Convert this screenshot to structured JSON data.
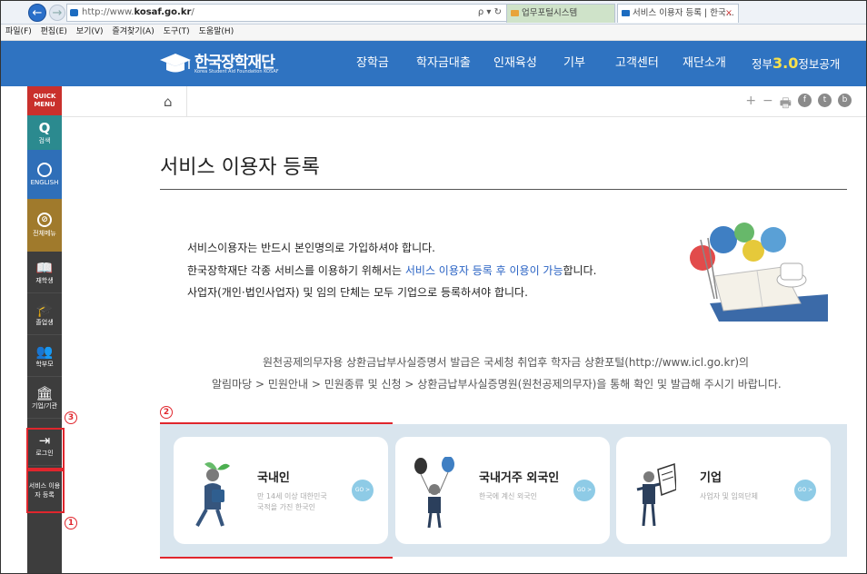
{
  "browser": {
    "url_prefix": "http://www.",
    "url_domain": "kosaf.go.kr",
    "url_suffix": "/",
    "url_controls": "ρ ▾ ↻",
    "tabs": [
      {
        "label": "업무포털시스템"
      },
      {
        "label": "서비스 이용자 등록 | 한국...",
        "close": "×"
      }
    ],
    "menu": [
      "파일(F)",
      "편집(E)",
      "보기(V)",
      "즐겨찾기(A)",
      "도구(T)",
      "도움말(H)"
    ]
  },
  "header": {
    "logo_name": "한국장학재단",
    "logo_sub": "Korea Student Aid Foundation KOSAF",
    "nav": [
      "장학금",
      "학자금대출",
      "인재육성",
      "기부",
      "고객센터",
      "재단소개"
    ],
    "gov_prefix": "정부",
    "gov_number": "3.0",
    "gov_suffix": "정보공개"
  },
  "quick_menu": {
    "top": "QUICK MENU",
    "items": [
      {
        "label": "검색",
        "icon": "search-icon"
      },
      {
        "label": "ENGLISH",
        "icon": "globe-icon"
      },
      {
        "label": "전체메뉴",
        "icon": "compass-icon"
      },
      {
        "label": "재학생",
        "icon": "book-icon"
      },
      {
        "label": "졸업생",
        "icon": "graduation-cap-icon"
      },
      {
        "label": "학부모",
        "icon": "people-icon"
      },
      {
        "label": "기업/기관",
        "icon": "building-icon"
      },
      {
        "label": "로그인",
        "icon": "login-icon"
      },
      {
        "label": "서비스 이용자 등록",
        "icon": ""
      }
    ]
  },
  "markers": {
    "m1": "1",
    "m2": "2",
    "m3": "3"
  },
  "toolbar": {
    "home": "⌂",
    "plus": "+",
    "minus": "−",
    "print": "🖶",
    "f": "f",
    "t": "t",
    "b": "b"
  },
  "page": {
    "title": "서비스 이용자 등록",
    "intro_line1": "서비스이용자는 반드시 본인명의로 가입하셔야 합니다.",
    "intro_line2_pre": "한국장학재단 각종 서비스를 이용하기 위해서는 ",
    "intro_line2_hl": "서비스 이용자 등록 후 이용이 가능",
    "intro_line2_post": "합니다.",
    "intro_line3": "사업자(개인·법인사업자) 및 임의 단체는 모두 기업으로 등록하셔야 합니다.",
    "notice_line1": "원천공제의무자용 상환금납부사실증명서 발급은 국세청 취업후 학자금 상환포털(http://www.icl.go.kr)의",
    "notice_line2": "알림마당 > 민원안내 > 민원종류 및 신청 > 상환금납부사실증명원(원천공제의무자)을 통해 확인 및 발급해 주시기 바랍니다."
  },
  "cards": [
    {
      "title": "국내인",
      "desc1": "만 14세 이상 대한민국",
      "desc2": "국적을 가진 한국인",
      "go": "GO >"
    },
    {
      "title": "국내거주 외국인",
      "desc1": "한국에 계신 외국인",
      "desc2": "",
      "go": "GO >"
    },
    {
      "title": "기업",
      "desc1": "사업자 및 임의단체",
      "desc2": "",
      "go": "GO >"
    }
  ],
  "colors": {
    "brand_blue": "#2f73c1",
    "quick_bg": "#3d3d3d",
    "highlight_red": "#e0262d",
    "panel_bg": "#d9e5ee",
    "link_blue": "#2a63c4"
  }
}
